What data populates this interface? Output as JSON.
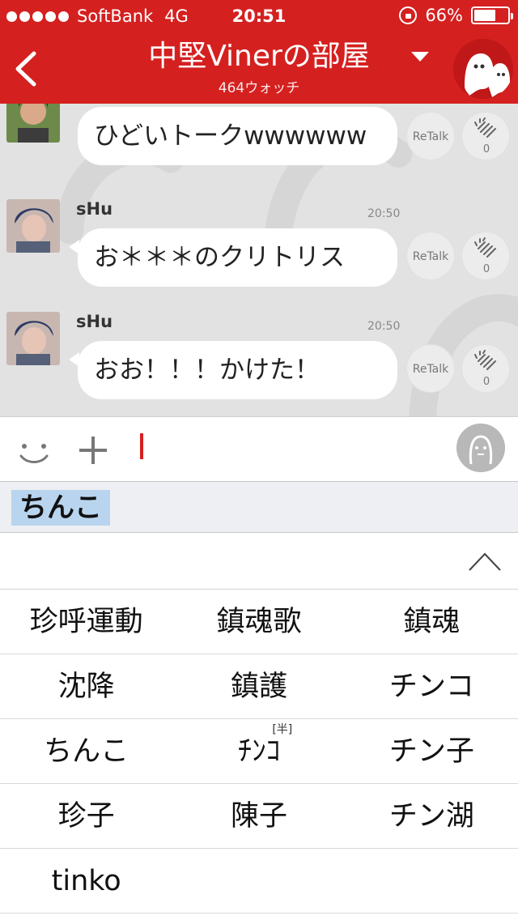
{
  "status_bar": {
    "carrier": "SoftBank",
    "network": "4G",
    "time": "20:51",
    "battery": "66%",
    "battery_level": 0.66
  },
  "header": {
    "title": "中堅Vinerの部屋",
    "subtitle": "464ウォッチ",
    "accent_color": "#d52020"
  },
  "messages": [
    {
      "name": "",
      "time": "",
      "text": "ひどいトークwwwwww",
      "retalk": "ReTalk",
      "claps": "0"
    },
    {
      "name": "sHu",
      "time": "20:50",
      "text": "お＊＊＊のクリトリス",
      "retalk": "ReTalk",
      "claps": "0"
    },
    {
      "name": "sHu",
      "time": "20:50",
      "text": "おお！！！かけた！",
      "retalk": "ReTalk",
      "claps": "0"
    }
  ],
  "composer": {
    "composing_text": "ちんこ"
  },
  "candidates": [
    [
      "珍呼運動",
      "鎮魂歌",
      "鎮魂"
    ],
    [
      "沈降",
      "鎮護",
      "チンコ"
    ],
    [
      "ちんこ",
      "ﾁﾝｺ",
      "チン子"
    ],
    [
      "珍子",
      "陳子",
      "チン湖"
    ],
    [
      "tinko",
      "",
      ""
    ]
  ],
  "candidate_tag": "[半]",
  "icons": {
    "back": "chevron-left-icon",
    "dropdown": "triangle-down-icon",
    "emoji": "smile-icon",
    "plus": "plus-icon",
    "clap": "clap-icon",
    "expand": "chevron-up-icon"
  }
}
